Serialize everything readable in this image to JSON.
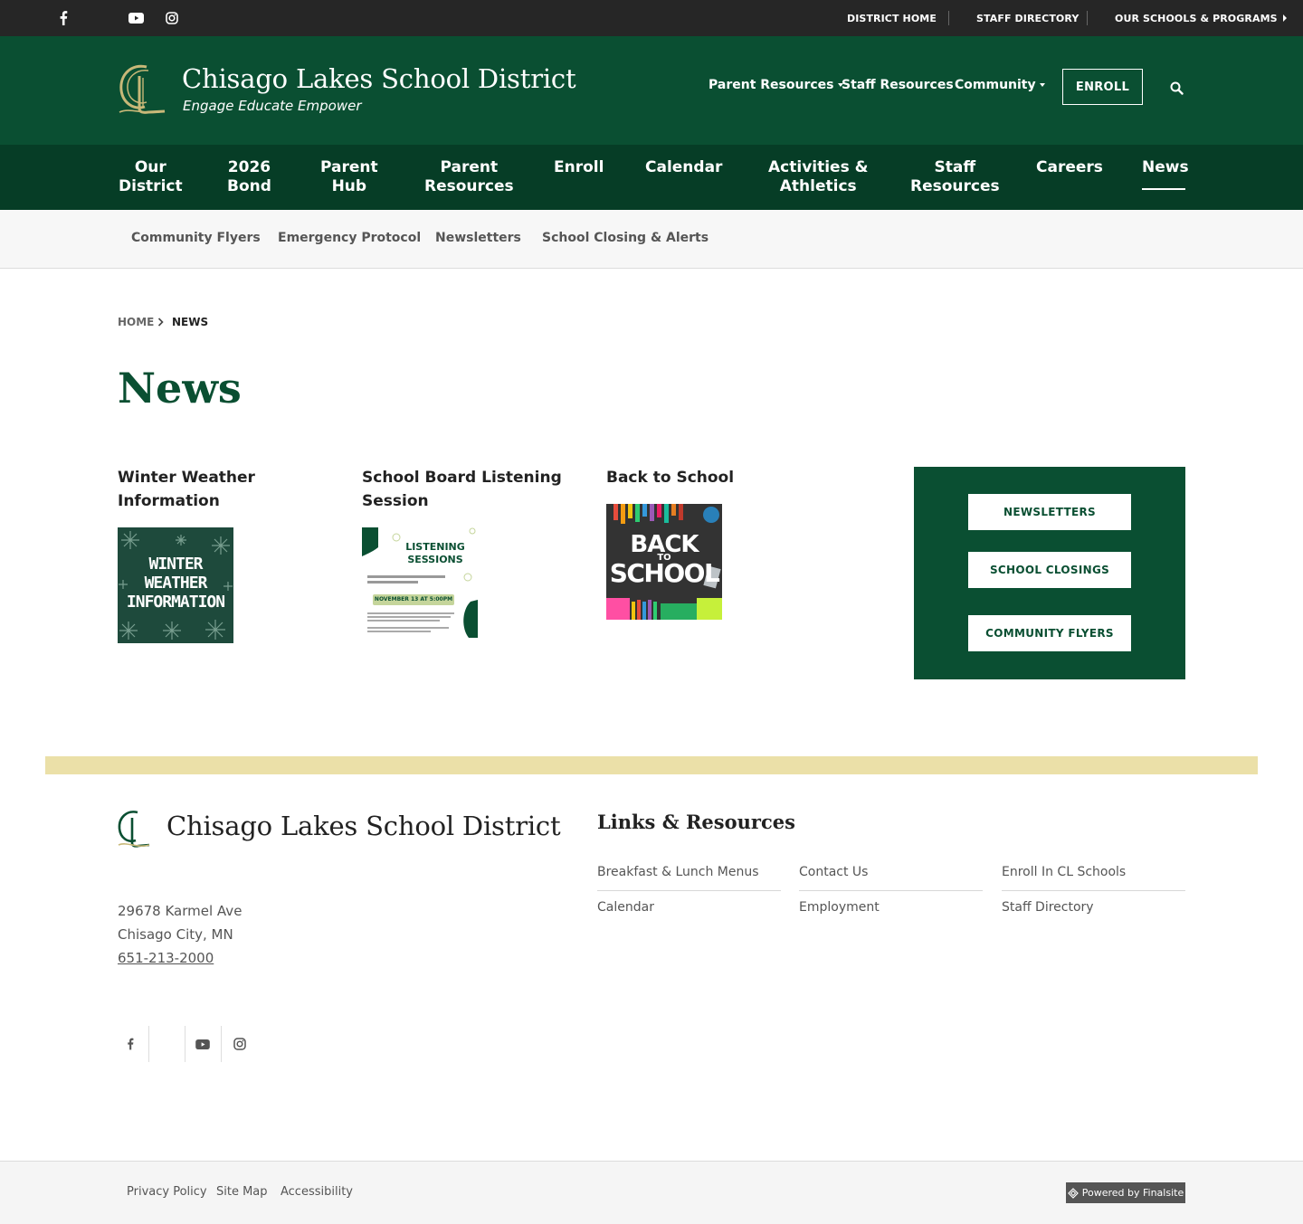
{
  "topbar": {
    "social": [
      "facebook-icon",
      "youtube-icon",
      "instagram-icon"
    ],
    "links": [
      {
        "label": "DISTRICT HOME"
      },
      {
        "label": "STAFF DIRECTORY"
      },
      {
        "label": "OUR SCHOOLS & PROGRAMS"
      }
    ]
  },
  "header": {
    "site_name": "Chisago Lakes School District",
    "tagline": "Engage Educate Empower",
    "nav": [
      {
        "label": "Parent Resources",
        "dropdown": true
      },
      {
        "label": "Staff Resources",
        "dropdown": false
      },
      {
        "label": "Community",
        "dropdown": true
      }
    ],
    "enroll_label": "ENROLL",
    "search_icon": "search-icon"
  },
  "main_nav": {
    "items": [
      {
        "line1": "Our",
        "line2": "District"
      },
      {
        "line1": "2026",
        "line2": "Bond"
      },
      {
        "line1": "Parent",
        "line2": "Hub"
      },
      {
        "line1": "Parent",
        "line2": "Resources"
      },
      {
        "line1": "Enroll",
        "line2": ""
      },
      {
        "line1": "Calendar",
        "line2": ""
      },
      {
        "line1": "Activities &",
        "line2": "Athletics"
      },
      {
        "line1": "Staff",
        "line2": "Resources"
      },
      {
        "line1": "Careers",
        "line2": ""
      },
      {
        "line1": "News",
        "line2": ""
      }
    ],
    "active": "News"
  },
  "sub_nav": {
    "items": [
      "Community Flyers",
      "Emergency Protocol",
      "Newsletters",
      "School Closing & Alerts"
    ]
  },
  "breadcrumb": {
    "home": "HOME",
    "separator": "›",
    "current": "NEWS"
  },
  "page_title": "News",
  "news": [
    {
      "title_line1": "Winter Weather",
      "title_line2": "Information",
      "image_text": [
        "WINTER",
        "WEATHER",
        "INFORMATION"
      ]
    },
    {
      "title_line1": "School Board Listening",
      "title_line2": "Session",
      "image_text": [
        "LISTENING",
        "SESSIONS",
        "NOVEMBER 13 AT 5:00PM"
      ]
    },
    {
      "title_line1": "Back to School",
      "title_line2": "",
      "image_text": [
        "BACK",
        "TO",
        "SCHOOL"
      ]
    }
  ],
  "quick_links": [
    "NEWSLETTERS",
    "SCHOOL CLOSINGS",
    "COMMUNITY FLYERS"
  ],
  "footer": {
    "site_name": "Chisago Lakes School District",
    "address_line1": "29678 Karmel Ave",
    "address_line2": "Chisago City, MN",
    "phone": "651-213-2000",
    "social": [
      "facebook-icon",
      "youtube-icon",
      "instagram-icon"
    ],
    "links_title": "Links & Resources",
    "links": [
      "Breakfast & Lunch Menus",
      "Contact Us",
      "Enroll In CL Schools",
      "Calendar",
      "Employment",
      "Staff Directory"
    ]
  },
  "bottom": {
    "links": [
      "Privacy Policy",
      "Site Map",
      "Accessibility"
    ],
    "powered_by": "Powered by Finalsite"
  },
  "colors": {
    "brand_green": "#0a4f32",
    "nav_green": "#063d26",
    "topbar": "#262626",
    "accent_band": "#ebe0a8",
    "logo_gold": "#c8b878"
  }
}
